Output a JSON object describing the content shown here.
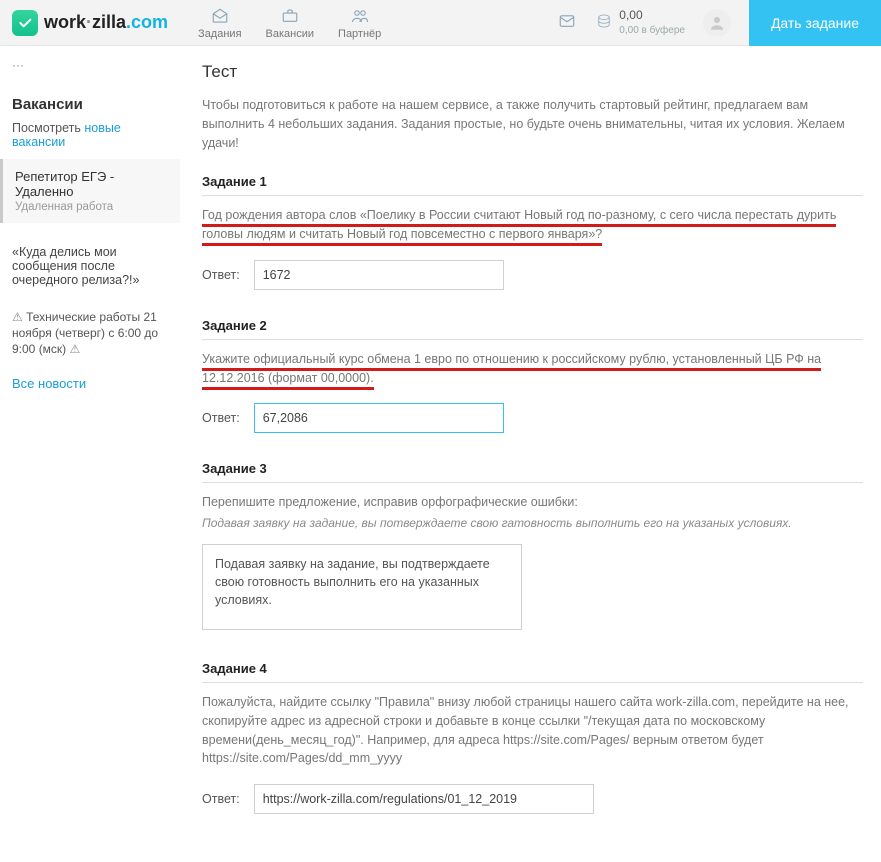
{
  "header": {
    "logo_text1": "work",
    "logo_text2": "zilla",
    "logo_text3": ".com",
    "nav": [
      {
        "label": "Задания"
      },
      {
        "label": "Вакансии"
      },
      {
        "label": "Партнёр"
      }
    ],
    "balance_value": "0,00",
    "balance_sub": "0,00 в буфере",
    "cta": "Дать задание"
  },
  "sidebar": {
    "vac_title": "Вакансии",
    "vac_look": "Посмотреть",
    "vac_link": "новые вакансии",
    "card_title": "Репетитор ЕГЭ - Удаленно",
    "card_sub": "Удаленная работа",
    "quote": "«Куда делись мои сообщения после очередного релиза?!»",
    "warn_prefix": "⚠",
    "warn_text": "Технические работы 21 ноября (четверг) с 6:00 до 9:00 (мск)",
    "all_news": "Все новости"
  },
  "main": {
    "title": "Тест",
    "intro": "Чтобы подготовиться к работе на нашем сервисе, а также получить стартовый рейтинг, предлагаем вам выполнить 4 небольших задания. Задания простые, но будьте очень внимательны, читая их условия. Желаем удачи!",
    "answer_label": "Ответ:",
    "task1": {
      "title": "Задание 1",
      "q": "Год рождения автора слов «Поелику в России считают Новый год по-разному, с сего числа перестать дурить головы людям и считать Новый год повсеместно с первого января»?",
      "value": "1672"
    },
    "task2": {
      "title": "Задание 2",
      "q": "Укажите официальный курс обмена 1 евро по отношению к российскому рублю, установленный ЦБ РФ на 12.12.2016 (формат 00,0000).",
      "value": "67,2086"
    },
    "task3": {
      "title": "Задание 3",
      "q": "Перепишите предложение, исправив орфографические ошибки:",
      "note": "Подавая заявку на задание, вы потверждаете свою гатовность выполнить его на указаных условиях.",
      "value": "Подавая заявку на задание, вы подтверждаете свою готовность выполнить его на указанных условиях."
    },
    "task4": {
      "title": "Задание 4",
      "q": "Пожалуйста, найдите ссылку \"Правила\" внизу любой страницы нашего сайта work-zilla.com, перейдите на нее, скопируйте адрес из адресной строки и добавьте в конце ссылки \"/текущая дата по московскому времени(день_месяц_год)\". Например, для адреса https://site.com/Pages/ верным ответом будет https://site.com/Pages/dd_mm_yyyy",
      "value": "https://work-zilla.com/regulations/01_12_2019"
    }
  }
}
